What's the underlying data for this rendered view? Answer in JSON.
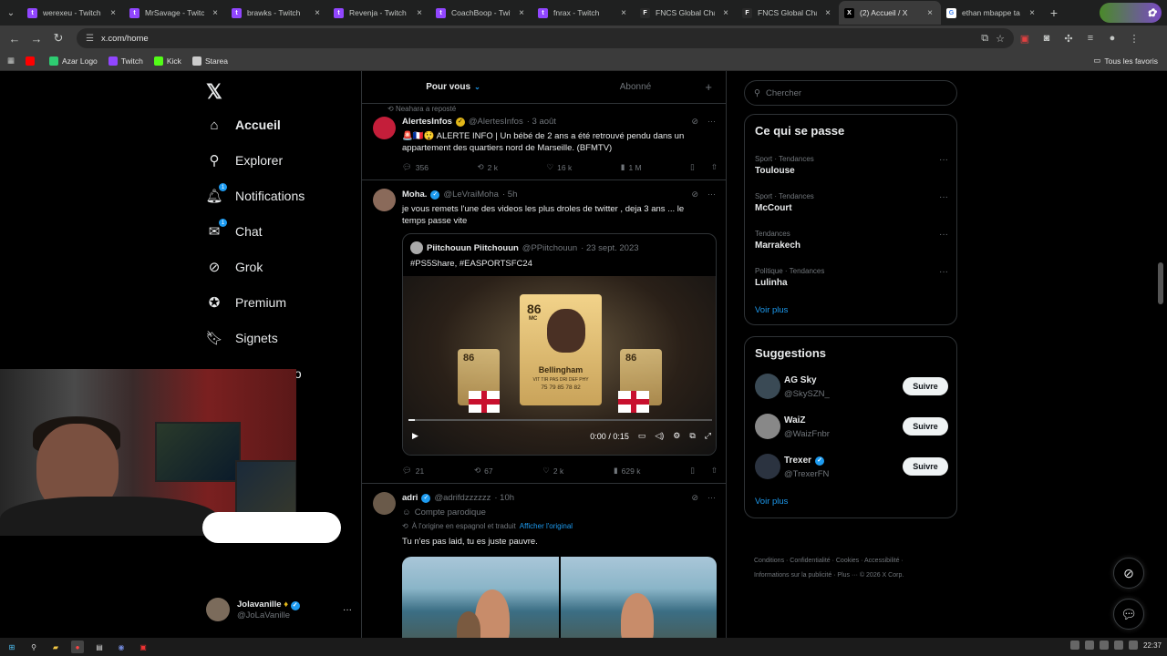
{
  "browser": {
    "tabs": [
      {
        "title": "werexeu - Twitch",
        "fav_color": "#9146ff",
        "fav": "t",
        "active": false
      },
      {
        "title": "MrSavage - Twitch",
        "fav_color": "#9146ff",
        "fav": "t",
        "active": false
      },
      {
        "title": "brawks - Twitch",
        "fav_color": "#9146ff",
        "fav": "t",
        "active": false
      },
      {
        "title": "Revenja - Twitch",
        "fav_color": "#9146ff",
        "fav": "t",
        "active": false
      },
      {
        "title": "CoachBoop - Twitch",
        "fav_color": "#9146ff",
        "fav": "t",
        "active": false
      },
      {
        "title": "fnrax - Twitch",
        "fav_color": "#9146ff",
        "fav": "t",
        "active": false
      },
      {
        "title": "FNCS Global Champ",
        "fav_color": "#2a2a2a",
        "fav": "F",
        "active": false
      },
      {
        "title": "FNCS Global Champ",
        "fav_color": "#2a2a2a",
        "fav": "F",
        "active": false
      },
      {
        "title": "(2) Accueil / X",
        "fav_color": "#000000",
        "fav": "X",
        "active": true
      },
      {
        "title": "ethan mbappe ta",
        "fav_color": "#ffffff",
        "fav": "G",
        "active": false
      }
    ],
    "new_tab": "+",
    "url": "x.com/home",
    "bookmarks": [
      {
        "label": "",
        "color": "#ff0000"
      },
      {
        "label": "Azar Logo",
        "color": "#2ecc71"
      },
      {
        "label": "Twitch",
        "color": "#9146ff"
      },
      {
        "label": "Kick",
        "color": "#53fc18"
      },
      {
        "label": "Starea",
        "color": "#cccccc"
      }
    ],
    "all_bookmarks": "Tous les favoris"
  },
  "nav": {
    "items": [
      {
        "label": "Accueil",
        "icon": "home-icon",
        "glyph": "⌂",
        "bold": true
      },
      {
        "label": "Explorer",
        "icon": "search-icon",
        "glyph": "⚲",
        "bold": false
      },
      {
        "label": "Notifications",
        "icon": "bell-icon",
        "glyph": "🔔︎",
        "bold": false,
        "badge": "1"
      },
      {
        "label": "Chat",
        "icon": "chat-icon",
        "glyph": "✉",
        "bold": false,
        "badge": "1"
      },
      {
        "label": "Grok",
        "icon": "grok-icon",
        "glyph": "⊘",
        "bold": false
      },
      {
        "label": "Premium",
        "icon": "premium-icon",
        "glyph": "✪",
        "bold": false
      },
      {
        "label": "Signets",
        "icon": "bookmark-icon",
        "glyph": "🔖︎",
        "bold": false
      },
      {
        "label": "dio",
        "icon": "studio-icon",
        "glyph": "",
        "bold": false
      }
    ],
    "account": {
      "name": "Jolavanille",
      "handle": "@JoLaVanille"
    }
  },
  "feed": {
    "tabs": {
      "for_you": "Pour vous",
      "following": "Abonné"
    },
    "tweet1": {
      "repost": "Neahara a reposté",
      "name": "AlertesInfos",
      "handle": "@AlertesInfos",
      "time": "· 3 août",
      "text": "🚨🇫🇷😲 ALERTE INFO | Un bébé de 2 ans a été retrouvé pendu dans un appartement des quartiers nord de Marseille. (BFMTV)",
      "replies": "356",
      "reposts": "2 k",
      "likes": "16 k",
      "views": "1 M"
    },
    "tweet2": {
      "name": "Moha.",
      "handle": "@LeVraiMoha",
      "time": "· 5h",
      "text": "je vous remets l'une des videos les plus droles de twitter , deja 3 ans ... le temps passe vite",
      "quote_name": "Piitchouun Piitchouun",
      "quote_handle": "@PPiitchouun",
      "quote_time": "· 23 sept. 2023",
      "quote_text": "#PS5Share, #EASPORTSFC24",
      "card_rating": "86",
      "card_pos": "MC",
      "card_name": "Bellingham",
      "card_stats_labels": "VIT TIR PAS DRI DEF PHY",
      "card_stats": "75 79 85 78 82",
      "video_time": "0:00 / 0:15",
      "video_progress": 0.02,
      "replies": "21",
      "reposts": "67",
      "likes": "2 k",
      "views": "629 k"
    },
    "tweet3": {
      "name": "adri",
      "handle": "@adrifdzzzzzz",
      "time": "· 10h",
      "parody": "Compte parodique",
      "translated": "À l'origine en espagnol et traduit",
      "translated_link": "Afficher l'original",
      "text": "Tu n'es pas laid, tu es juste pauvre."
    }
  },
  "right": {
    "search_placeholder": "Chercher",
    "trends_title": "Ce qui se passe",
    "trends": [
      {
        "category": "Sport · Tendances",
        "name": "Toulouse"
      },
      {
        "category": "Sport · Tendances",
        "name": "McCourt"
      },
      {
        "category": "Tendances",
        "name": "Marrakech"
      },
      {
        "category": "Politique · Tendances",
        "name": "Lulinha"
      }
    ],
    "see_more": "Voir plus",
    "suggestions_title": "Suggestions",
    "suggestions": [
      {
        "name": "AG Sky",
        "handle": "@SkySZN_",
        "verified": false,
        "color": "#3a4a55"
      },
      {
        "name": "WaiZ",
        "handle": "@WaizFnbr",
        "verified": false,
        "color": "#888888"
      },
      {
        "name": "Trexer",
        "handle": "@TrexerFN",
        "verified": true,
        "color": "#2b3340"
      }
    ],
    "follow_label": "Suivre",
    "footer": {
      "line1": "Conditions · Confidentialité · Cookies · Accessibilité ·",
      "line2": "Informations sur la publicité · Plus ··· © 2026 X Corp."
    }
  },
  "system": {
    "clock": "22:37"
  }
}
